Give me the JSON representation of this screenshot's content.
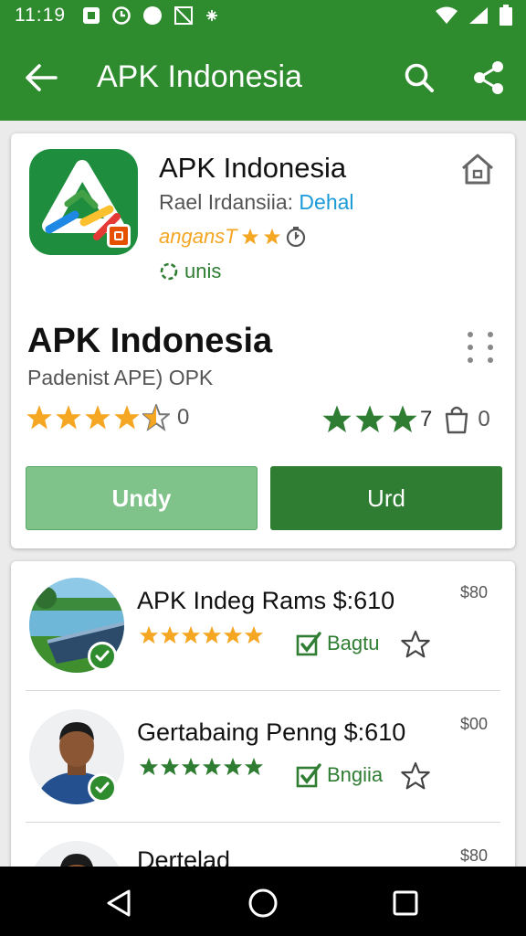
{
  "status_bar": {
    "time": "11:19"
  },
  "toolbar": {
    "title": "APK Indonesia"
  },
  "app": {
    "name": "APK Indonesia",
    "developer": "Rael Irdansiia: ",
    "developer_link": "Dehal",
    "rating_label": "angansT",
    "installs_label": "unis",
    "big_title": "APK Indonesia",
    "subtitle": "Padenist APE) OPK",
    "left_rating_count": "0",
    "right_rating_value": "7",
    "right_count": "0",
    "btn_light_label": "Undy",
    "btn_dark_label": "Urd"
  },
  "list": {
    "items": [
      {
        "title": "APK Indeg Rams $:610",
        "price": "$80",
        "check_label": "Bagtu"
      },
      {
        "title": "Gertabaing Penng $:610",
        "price": "$00",
        "check_label": "Bngiia"
      },
      {
        "title": "Dertelad",
        "price": "$80"
      }
    ]
  },
  "colors": {
    "primary": "#2e8b2e",
    "primary_dark": "#2e7d32",
    "primary_light": "#7fc28a",
    "star_orange": "#f5a623",
    "link_blue": "#1a9bd7"
  },
  "icons": [
    "back-arrow-icon",
    "search-icon",
    "share-icon",
    "home-icon",
    "more-vert-icon",
    "star-icon",
    "check-box-icon",
    "verified-icon",
    "nav-back-icon",
    "nav-home-icon",
    "nav-recents-icon"
  ]
}
